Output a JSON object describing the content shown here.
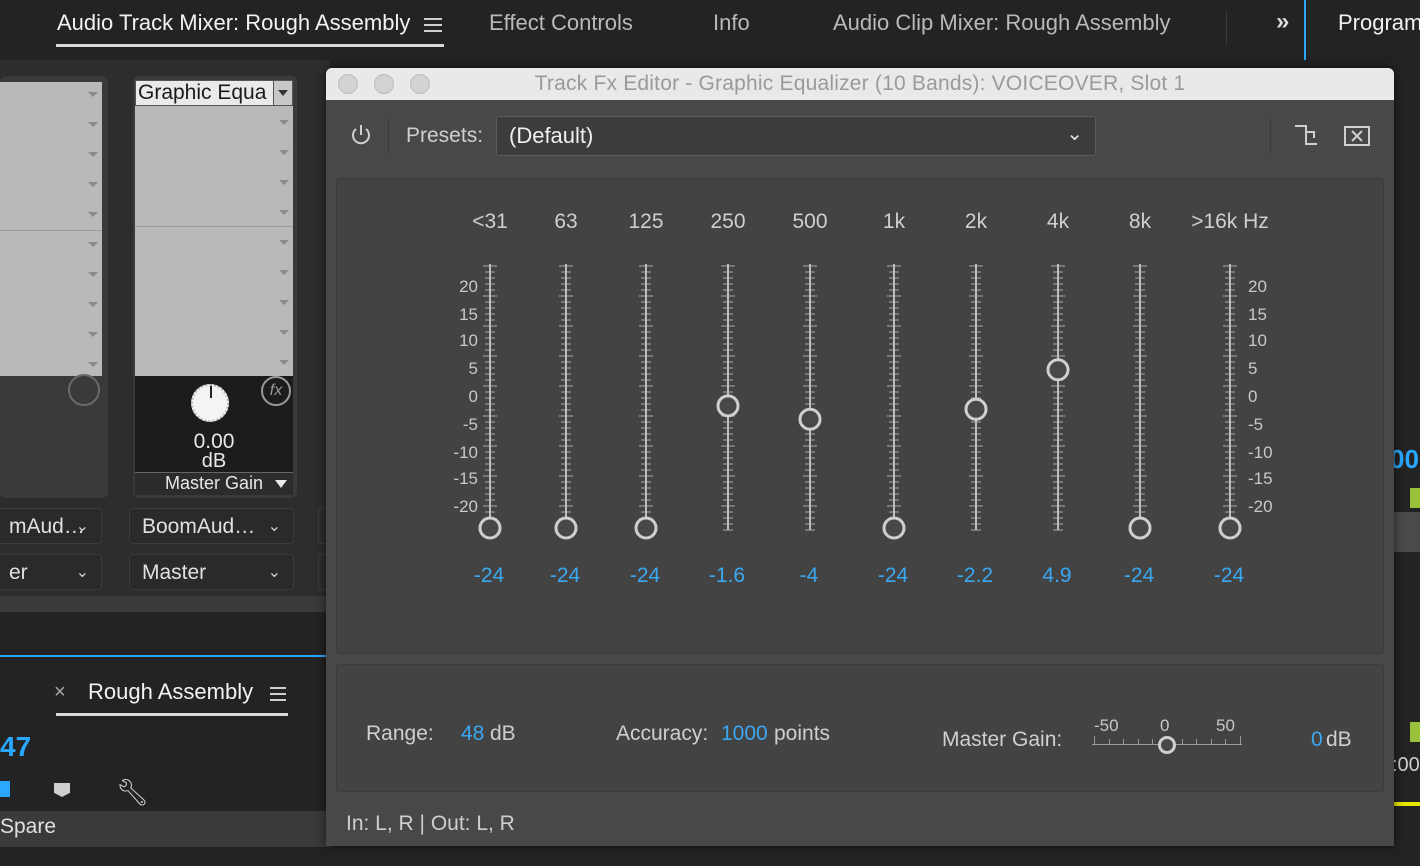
{
  "tabs": [
    {
      "label": "Audio Track Mixer: Rough Assembly",
      "active": true
    },
    {
      "label": "Effect Controls"
    },
    {
      "label": "Info"
    },
    {
      "label": "Audio Clip Mixer: Rough Assembly"
    }
  ],
  "overflow_icon": "»",
  "program_tab": "Program",
  "mixer": {
    "slot_label": "Graphic Equa",
    "gain_value": "0.00",
    "gain_unit": "dB",
    "param_label": "Master Gain",
    "strip1_input": "mAud…",
    "strip1_output": "er",
    "strip2_input": "BoomAud…",
    "strip2_output": "Master"
  },
  "timeline": {
    "tab_label": "Rough Assembly",
    "timecode": "47",
    "track_label": "Spare"
  },
  "program_readouts": {
    "timecode_top": "00",
    "timecode_bottom": ":00"
  },
  "dialog": {
    "title": "Track Fx Editor - Graphic Equalizer (10 Bands): VOICEOVER, Slot 1",
    "presets_label": "Presets:",
    "preset_value": "(Default)",
    "bands": [
      {
        "freq": "<31",
        "value": "-24",
        "level": -24
      },
      {
        "freq": "63",
        "value": "-24",
        "level": -24
      },
      {
        "freq": "125",
        "value": "-24",
        "level": -24
      },
      {
        "freq": "250",
        "value": "-1.6",
        "level": -1.6
      },
      {
        "freq": "500",
        "value": "-4",
        "level": -4
      },
      {
        "freq": "1k",
        "value": "-24",
        "level": -24
      },
      {
        "freq": "2k",
        "value": "-2.2",
        "level": -2.2
      },
      {
        "freq": "4k",
        "value": "4.9",
        "level": 4.9
      },
      {
        "freq": "8k",
        "value": "-24",
        "level": -24
      },
      {
        "freq": ">16k Hz",
        "value": "-24",
        "level": -24
      }
    ],
    "scale_labels": [
      "20",
      "15",
      "10",
      "5",
      "0",
      "-5",
      "-10",
      "-15",
      "-20"
    ],
    "range_label": "Range:",
    "range_value": "48",
    "range_unit": "dB",
    "accuracy_label": "Accuracy:",
    "accuracy_value": "1000",
    "accuracy_unit": "points",
    "master_gain_label": "Master Gain:",
    "master_gain_ticks": [
      "-50",
      "0",
      "50"
    ],
    "master_gain_value": "0",
    "master_gain_unit": "dB",
    "master_gain_level": 0,
    "io_status": "In: L, R | Out: L, R"
  },
  "colors": {
    "accent_blue": "#3aa8f0",
    "panel_bg": "#484848",
    "highlight": "#2aa7ff"
  }
}
